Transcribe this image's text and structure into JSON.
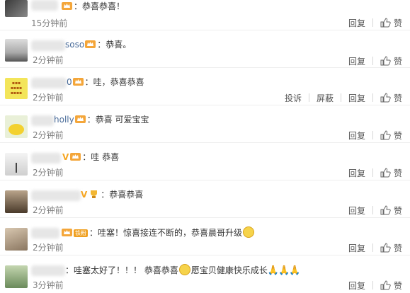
{
  "actions": {
    "reply": "回复",
    "like": "赞",
    "report": "投诉",
    "block": "屏蔽"
  },
  "comments": [
    {
      "name": "",
      "text": "：恭喜恭喜！",
      "time": "15分钟前"
    },
    {
      "name": "soso",
      "text": "：恭喜。",
      "time": "2分钟前"
    },
    {
      "name": "0",
      "text": "：哇，恭喜恭喜",
      "time": "2分钟前"
    },
    {
      "name": "holly",
      "text": "：恭喜 可爱宝宝",
      "time": "2分钟前"
    },
    {
      "name": "",
      "text": "：哇 恭喜",
      "time": "2分钟前"
    },
    {
      "name": "",
      "text": "：恭喜恭喜",
      "time": "2分钟前"
    },
    {
      "name": "",
      "tag": "铁粉",
      "text": "：哇塞！惊喜接连不断的，恭喜晨哥升级",
      "time": "2分钟前"
    },
    {
      "name": "",
      "text": "：哇塞太好了！！！ 恭喜恭喜",
      "text2": "愿宝贝健康快乐成长",
      "time": "3分钟前"
    }
  ]
}
